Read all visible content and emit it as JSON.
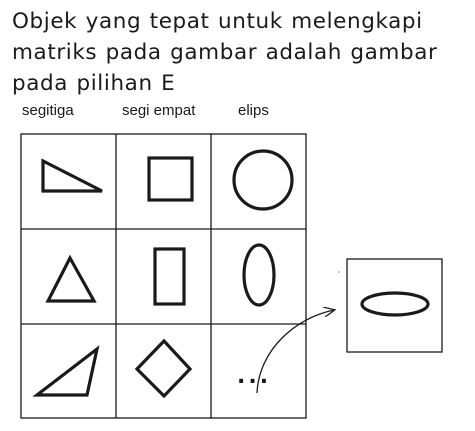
{
  "question": {
    "lines": [
      "Objek yang tepat untuk melengkapi",
      "matriks pada gambar adalah gambar",
      "pada pilihan E"
    ]
  },
  "columns": [
    "segitiga",
    "segi empat",
    "elips"
  ],
  "grid": {
    "rows": [
      [
        "right-triangle-icon",
        "square-icon",
        "circle-icon"
      ],
      [
        "isosceles-triangle-icon",
        "tall-rectangle-icon",
        "tall-ellipse-icon"
      ],
      [
        "scalene-triangle-icon",
        "diamond-icon",
        "missing-dots"
      ]
    ]
  },
  "missing_cell_text": "...",
  "answer_shape": "flat-ellipse-icon",
  "colors": {
    "stroke": "#1a1a1a",
    "background": "#ffffff"
  }
}
